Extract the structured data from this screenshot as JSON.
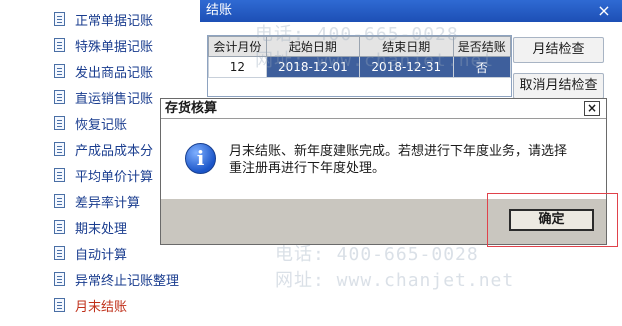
{
  "tree": {
    "items": [
      {
        "label": "正常单据记账"
      },
      {
        "label": "特殊单据记账"
      },
      {
        "label": "发出商品记账"
      },
      {
        "label": "直运销售记账"
      },
      {
        "label": "恢复记账"
      },
      {
        "label": "产成品成本分"
      },
      {
        "label": "平均单价计算"
      },
      {
        "label": "差异率计算"
      },
      {
        "label": "期末处理"
      },
      {
        "label": "自动计算"
      },
      {
        "label": "异常终止记账整理"
      },
      {
        "label": "月末结账"
      }
    ]
  },
  "watermark": {
    "phone": "电话: 400-665-0028",
    "site": "网址: www.chanjet.net"
  },
  "window": {
    "title": "结账",
    "close_glyph": "×",
    "table": {
      "headers": [
        "会计月份",
        "起始日期",
        "结束日期",
        "是否结账"
      ],
      "rows": [
        [
          "12",
          "2018-12-01",
          "2018-12-31",
          "否"
        ]
      ]
    },
    "check_button": "月结检查",
    "cancel_check_button": "取消月结检查"
  },
  "modal": {
    "title": "存货核算",
    "close_glyph": "×",
    "icon_glyph": "i",
    "message_line1": "月末结账、新年度建账完成。若想进行下年度业务，请选择",
    "message_line2": "重注册再进行下年度处理。",
    "ok_button": "确定"
  },
  "colors": {
    "title_bar": "#2f6ad3",
    "selected_row": "#3e5f9c",
    "highlight_box": "#e0424b",
    "dialog_bg": "#c9c6bf"
  }
}
